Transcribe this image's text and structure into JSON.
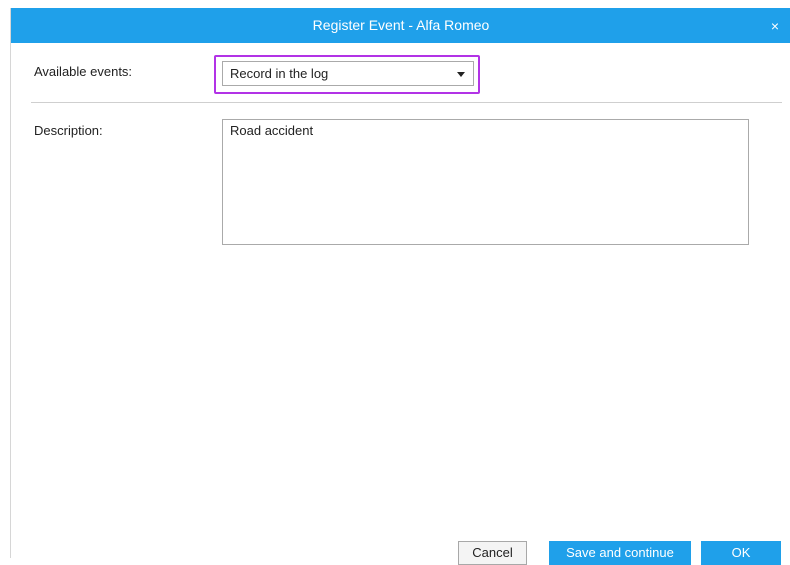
{
  "dialog": {
    "title": "Register Event - Alfa Romeo",
    "close_glyph": "×"
  },
  "form": {
    "events_label": "Available events:",
    "events_selected": "Record in the log",
    "description_label": "Description:",
    "description_value": "Road accident"
  },
  "buttons": {
    "cancel": "Cancel",
    "save_continue": "Save and continue",
    "ok": "OK"
  },
  "colors": {
    "accent": "#1fa0ea",
    "highlight": "#b233e6"
  },
  "icons": {
    "close": "close-icon",
    "dropdown": "chevron-down-icon"
  }
}
